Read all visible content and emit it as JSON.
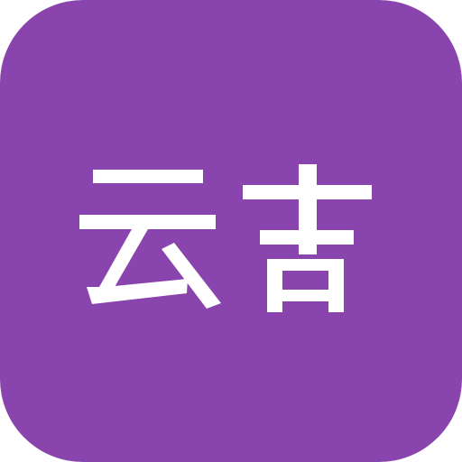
{
  "app_icon": {
    "label": "云吉",
    "background_color": "#8a44ad",
    "foreground_color": "#ffffff",
    "icon_name": "app-icon-tile"
  }
}
